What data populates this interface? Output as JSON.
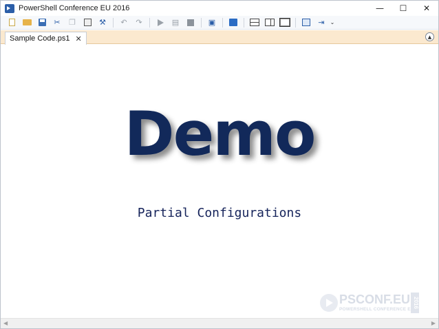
{
  "window": {
    "title": "PowerShell Conference EU 2016",
    "controls": {
      "minimize": "—",
      "maximize": "☐",
      "close": "✕"
    }
  },
  "toolbar": {
    "icons": [
      "new-file-icon",
      "open-folder-icon",
      "save-icon",
      "cut-icon",
      "copy-icon",
      "paste-icon",
      "clear-icon",
      "undo-icon",
      "redo-icon",
      "run-icon",
      "run-selection-icon",
      "stop-icon",
      "new-remote-tab-icon",
      "start-powershell-icon",
      "pane-top-icon",
      "pane-right-icon",
      "pane-maximized-icon",
      "show-script-pane-icon",
      "show-commands-icon",
      "toolbar-overflow-icon"
    ]
  },
  "tabs": [
    {
      "label": "Sample Code.ps1",
      "close": "✕"
    }
  ],
  "editor": {
    "title": "Demo",
    "subtitle": "Partial Configurations"
  },
  "watermark": {
    "main": "PSCONF.EU",
    "sub": "POWERSHELL CONFERENCE EU",
    "year": "2016"
  },
  "colors": {
    "title_text": "#12295a",
    "tab_strip": "#fbe9cf",
    "toolbar_bg": "#f6f8fb"
  }
}
